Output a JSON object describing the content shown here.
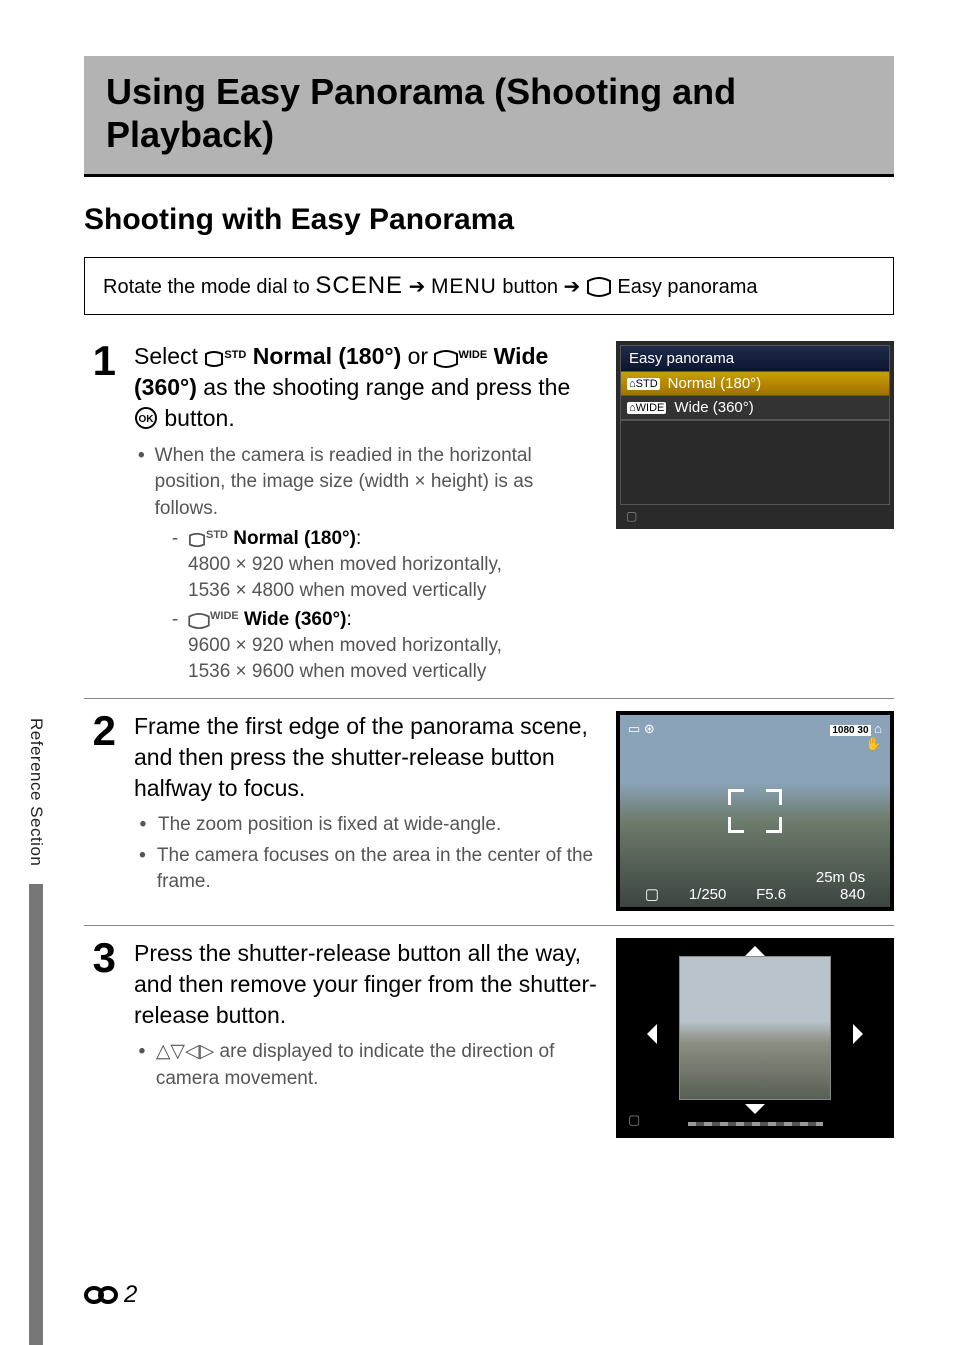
{
  "side_label": "Reference Section",
  "title": "Using Easy Panorama (Shooting and Playback)",
  "section_heading": "Shooting with Easy Panorama",
  "nav": {
    "prefix": "Rotate the mode dial to ",
    "scene": "SCENE",
    "arrow": "➔",
    "menu": "MENU",
    "button_word": " button ",
    "suffix": " Easy panorama"
  },
  "steps": {
    "s1": {
      "num": "1",
      "main_pre": "Select ",
      "std_icon_label": "STD",
      "normal_bold": " Normal (180°)",
      "mid": " or ",
      "wide_icon_label": "WIDE",
      "wide_bold": " Wide (360°)",
      "main_post": " as the shooting range and press the ",
      "ok_after": " button.",
      "bullet1": "When the camera is readied in the horizontal position, the image size (width × height) is as follows.",
      "normal_title": " Normal (180°)",
      "normal_detail1": "4800 × 920 when moved horizontally,",
      "normal_detail2": "1536 × 4800 when moved vertically",
      "wide_title": " Wide (360°)",
      "wide_detail1": "9600 × 920 when moved horizontally,",
      "wide_detail2": "1536 × 9600 when moved vertically"
    },
    "s2": {
      "num": "2",
      "main": "Frame the first edge of the panorama scene, and then press the shutter-release button halfway to focus.",
      "bullet1": "The zoom position is fixed at wide-angle.",
      "bullet2": "The camera focuses on the area in the center of the frame."
    },
    "s3": {
      "num": "3",
      "main": "Press the shutter-release button all the way, and then remove your finger from the shutter-release button.",
      "bullet1_after": " are displayed to indicate the direction of camera movement."
    }
  },
  "lcd": {
    "title": "Easy panorama",
    "opt1_icon": "STD",
    "opt1": "Normal (180°)",
    "opt2_icon": "WIDE",
    "opt2": "Wide (360°)",
    "batt": "▢"
  },
  "viewfinder": {
    "shutter": "1/250",
    "aperture": "F5.6",
    "time": "25m 0s",
    "shots": "840",
    "rec_badge": "1080 30"
  },
  "footer": {
    "page": "2"
  }
}
